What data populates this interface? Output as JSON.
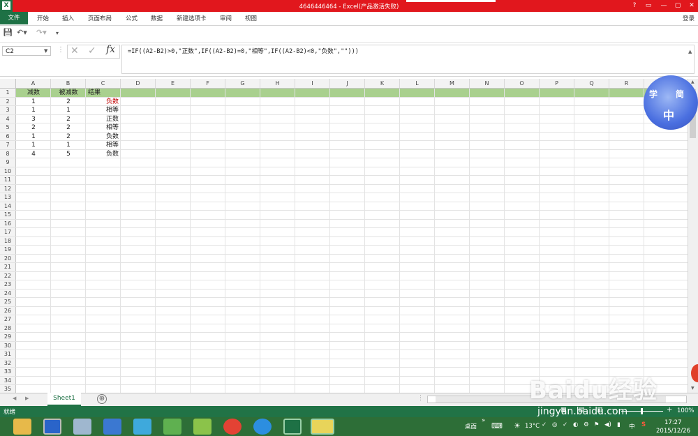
{
  "window": {
    "title": "4646446464 -  Excel(产品激活失败)",
    "controls": [
      "?",
      "▭",
      "—",
      "▢",
      "✕"
    ]
  },
  "ribbon": {
    "file": "文件",
    "tabs": [
      "开始",
      "插入",
      "页面布局",
      "公式",
      "数据",
      "新建选项卡",
      "审阅",
      "视图"
    ],
    "login": "登录"
  },
  "formula_bar": {
    "name_box": "C2",
    "fx": "fx",
    "formula": "=IF((A2-B2)>0,\"正数\",IF((A2-B2)=0,\"相等\",IF((A2-B2)<0,\"负数\",\"\")))"
  },
  "columns": [
    "A",
    "B",
    "C",
    "D",
    "E",
    "F",
    "G",
    "H",
    "I",
    "J",
    "K",
    "L",
    "M",
    "N",
    "O",
    "P",
    "Q",
    "R"
  ],
  "row_numbers": [
    "1",
    "2",
    "3",
    "4",
    "5",
    "6",
    "7",
    "8",
    "9",
    "10",
    "11",
    "12",
    "13",
    "14",
    "15",
    "16",
    "17",
    "18",
    "19",
    "20",
    "21",
    "22",
    "23",
    "24",
    "25",
    "26",
    "27",
    "28",
    "29",
    "30",
    "31",
    "32",
    "33",
    "34",
    "35"
  ],
  "table": {
    "headers": [
      "减数",
      "被减数",
      "结果"
    ],
    "rows": [
      [
        "1",
        "2",
        "负数"
      ],
      [
        "1",
        "1",
        "相等"
      ],
      [
        "3",
        "2",
        "正数"
      ],
      [
        "2",
        "2",
        "相等"
      ],
      [
        "1",
        "2",
        "负数"
      ],
      [
        "1",
        "1",
        "相等"
      ],
      [
        "4",
        "5",
        "负数"
      ]
    ],
    "selected_result_color": "#c00000"
  },
  "logo": {
    "chars": [
      "学",
      "简",
      "中"
    ]
  },
  "sheet_tabs": {
    "active": "Sheet1",
    "add": "⊕"
  },
  "status": {
    "left": "就绪",
    "zoom": "100%",
    "zoom_minus": "−",
    "zoom_plus": "+"
  },
  "taskbar": {
    "desktop": "桌面",
    "temperature": "13°C",
    "ime": "中",
    "time": "17:27",
    "date": "2015/12/26",
    "icons": [
      "file-explorer",
      "sogou",
      "calculator",
      "pen",
      "network",
      "transfer",
      "puzzle",
      "chrome",
      "ie",
      "excel",
      "qq-pet"
    ]
  },
  "watermark": {
    "brand": "Baidu经验",
    "url": "jingyan.baidu.com"
  },
  "colors": {
    "excel_green": "#217346",
    "title_red": "#e1171d",
    "header_row_green": "#a9d08e"
  }
}
